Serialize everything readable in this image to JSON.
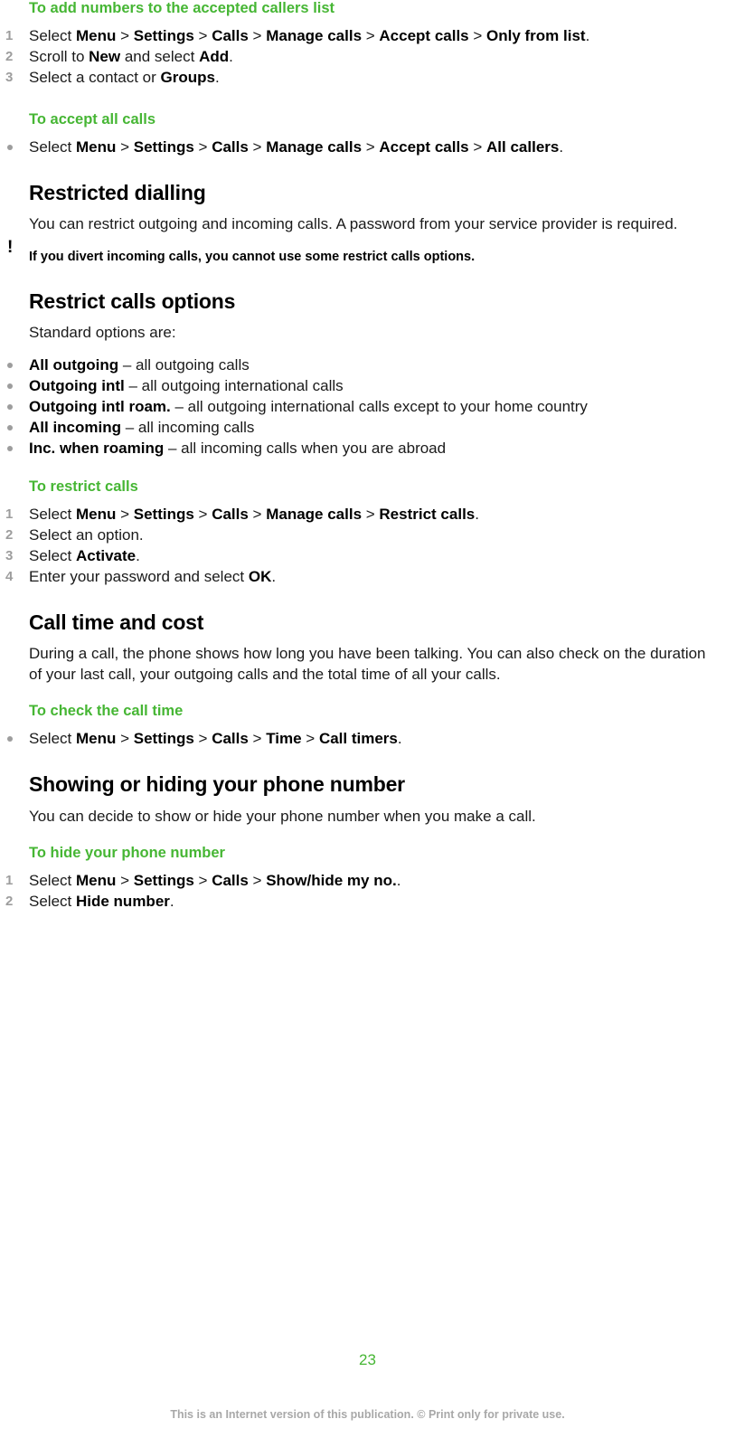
{
  "theme": {
    "accent_green": "#46b634",
    "marker_gray": "#9d9d9d",
    "footer_gray": "#a8a8a8",
    "text_black": "#1a1a1a"
  },
  "sections": {
    "add_numbers": {
      "heading": "To add numbers to the accepted callers list",
      "steps": [
        {
          "num": "1",
          "parts": [
            {
              "t": "Select ",
              "b": false
            },
            {
              "t": "Menu",
              "b": true
            },
            {
              "t": " > ",
              "b": false
            },
            {
              "t": "Settings",
              "b": true
            },
            {
              "t": " > ",
              "b": false
            },
            {
              "t": "Calls",
              "b": true
            },
            {
              "t": " > ",
              "b": false
            },
            {
              "t": "Manage calls",
              "b": true
            },
            {
              "t": " > ",
              "b": false
            },
            {
              "t": "Accept calls",
              "b": true
            },
            {
              "t": " > ",
              "b": false
            },
            {
              "t": "Only from list",
              "b": true
            },
            {
              "t": ".",
              "b": false
            }
          ]
        },
        {
          "num": "2",
          "parts": [
            {
              "t": "Scroll to ",
              "b": false
            },
            {
              "t": "New",
              "b": true
            },
            {
              "t": " and select ",
              "b": false
            },
            {
              "t": "Add",
              "b": true
            },
            {
              "t": ".",
              "b": false
            }
          ]
        },
        {
          "num": "3",
          "parts": [
            {
              "t": "Select a contact or ",
              "b": false
            },
            {
              "t": "Groups",
              "b": true
            },
            {
              "t": ".",
              "b": false
            }
          ]
        }
      ]
    },
    "accept_all": {
      "heading": "To accept all calls",
      "bullets": [
        {
          "parts": [
            {
              "t": "Select ",
              "b": false
            },
            {
              "t": "Menu",
              "b": true
            },
            {
              "t": " > ",
              "b": false
            },
            {
              "t": "Settings",
              "b": true
            },
            {
              "t": " > ",
              "b": false
            },
            {
              "t": "Calls",
              "b": true
            },
            {
              "t": " > ",
              "b": false
            },
            {
              "t": "Manage calls",
              "b": true
            },
            {
              "t": " > ",
              "b": false
            },
            {
              "t": "Accept calls",
              "b": true
            },
            {
              "t": " > ",
              "b": false
            },
            {
              "t": "All callers",
              "b": true
            },
            {
              "t": ".",
              "b": false
            }
          ]
        }
      ]
    },
    "restricted_dialling": {
      "heading": "Restricted dialling",
      "paragraph": "You can restrict outgoing and incoming calls. A password from your service provider is required.",
      "note_icon": "exclamation-icon",
      "note": "If you divert incoming calls, you cannot use some restrict calls options."
    },
    "restrict_options": {
      "heading": "Restrict calls options",
      "intro": "Standard options are:",
      "bullets": [
        {
          "parts": [
            {
              "t": "All outgoing",
              "b": true
            },
            {
              "t": " – all outgoing calls",
              "b": false
            }
          ]
        },
        {
          "parts": [
            {
              "t": "Outgoing intl",
              "b": true
            },
            {
              "t": " – all outgoing international calls",
              "b": false
            }
          ]
        },
        {
          "parts": [
            {
              "t": "Outgoing intl roam.",
              "b": true
            },
            {
              "t": " – all outgoing international calls except to your home country",
              "b": false
            }
          ]
        },
        {
          "parts": [
            {
              "t": "All incoming",
              "b": true
            },
            {
              "t": " – all incoming calls",
              "b": false
            }
          ]
        },
        {
          "parts": [
            {
              "t": "Inc. when roaming",
              "b": true
            },
            {
              "t": " – all incoming calls when you are abroad",
              "b": false
            }
          ]
        }
      ]
    },
    "to_restrict_calls": {
      "heading": "To restrict calls",
      "steps": [
        {
          "num": "1",
          "parts": [
            {
              "t": "Select ",
              "b": false
            },
            {
              "t": "Menu",
              "b": true
            },
            {
              "t": " > ",
              "b": false
            },
            {
              "t": "Settings",
              "b": true
            },
            {
              "t": " > ",
              "b": false
            },
            {
              "t": "Calls",
              "b": true
            },
            {
              "t": " > ",
              "b": false
            },
            {
              "t": "Manage calls",
              "b": true
            },
            {
              "t": " > ",
              "b": false
            },
            {
              "t": "Restrict calls",
              "b": true
            },
            {
              "t": ".",
              "b": false
            }
          ]
        },
        {
          "num": "2",
          "parts": [
            {
              "t": "Select an option.",
              "b": false
            }
          ]
        },
        {
          "num": "3",
          "parts": [
            {
              "t": "Select ",
              "b": false
            },
            {
              "t": "Activate",
              "b": true
            },
            {
              "t": ".",
              "b": false
            }
          ]
        },
        {
          "num": "4",
          "parts": [
            {
              "t": "Enter your password and select ",
              "b": false
            },
            {
              "t": "OK",
              "b": true
            },
            {
              "t": ".",
              "b": false
            }
          ]
        }
      ]
    },
    "call_time_cost": {
      "heading": "Call time and cost",
      "paragraph": "During a call, the phone shows how long you have been talking. You can also check on the duration of your last call, your outgoing calls and the total time of all your calls."
    },
    "check_call_time": {
      "heading": "To check the call time",
      "bullets": [
        {
          "parts": [
            {
              "t": "Select ",
              "b": false
            },
            {
              "t": "Menu",
              "b": true
            },
            {
              "t": " > ",
              "b": false
            },
            {
              "t": "Settings",
              "b": true
            },
            {
              "t": " > ",
              "b": false
            },
            {
              "t": "Calls",
              "b": true
            },
            {
              "t": " > ",
              "b": false
            },
            {
              "t": "Time",
              "b": true
            },
            {
              "t": " > ",
              "b": false
            },
            {
              "t": "Call timers",
              "b": true
            },
            {
              "t": ".",
              "b": false
            }
          ]
        }
      ]
    },
    "show_hide_number": {
      "heading": "Showing or hiding your phone number",
      "paragraph": "You can decide to show or hide your phone number when you make a call."
    },
    "hide_number": {
      "heading": "To hide your phone number",
      "steps": [
        {
          "num": "1",
          "parts": [
            {
              "t": "Select ",
              "b": false
            },
            {
              "t": "Menu",
              "b": true
            },
            {
              "t": " > ",
              "b": false
            },
            {
              "t": "Settings",
              "b": true
            },
            {
              "t": " > ",
              "b": false
            },
            {
              "t": "Calls",
              "b": true
            },
            {
              "t": " > ",
              "b": false
            },
            {
              "t": "Show/hide my no.",
              "b": true
            },
            {
              "t": ".",
              "b": false
            }
          ]
        },
        {
          "num": "2",
          "parts": [
            {
              "t": "Select ",
              "b": false
            },
            {
              "t": "Hide number",
              "b": true
            },
            {
              "t": ".",
              "b": false
            }
          ]
        }
      ]
    }
  },
  "footer": {
    "page_number": "23",
    "disclaimer": "This is an Internet version of this publication. © Print only for private use."
  }
}
